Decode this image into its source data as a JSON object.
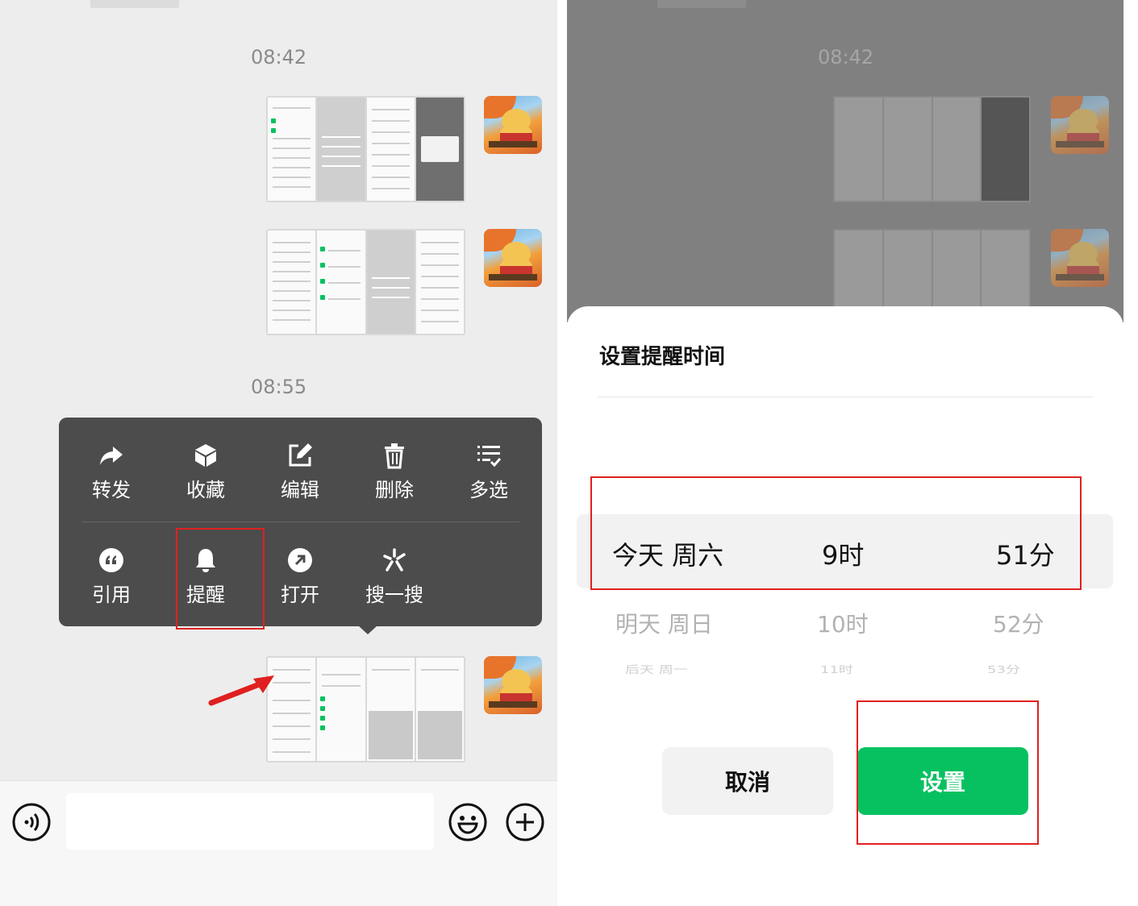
{
  "left": {
    "timestamps": [
      "08:42",
      "08:55"
    ],
    "menu": {
      "row1": [
        {
          "label": "转发",
          "icon": "share-arrow-icon"
        },
        {
          "label": "收藏",
          "icon": "cube-icon"
        },
        {
          "label": "编辑",
          "icon": "edit-icon"
        },
        {
          "label": "删除",
          "icon": "trash-icon"
        },
        {
          "label": "多选",
          "icon": "multi-select-icon"
        }
      ],
      "row2": [
        {
          "label": "引用",
          "icon": "quote-icon"
        },
        {
          "label": "提醒",
          "icon": "bell-icon"
        },
        {
          "label": "打开",
          "icon": "open-arrow-icon"
        },
        {
          "label": "搜一搜",
          "icon": "search-spark-icon"
        }
      ]
    },
    "input_bar": {
      "voice_icon": "voice-icon",
      "emoji_icon": "emoji-icon",
      "plus_icon": "plus-icon"
    }
  },
  "right": {
    "timestamps": [
      "08:42"
    ],
    "sheet": {
      "title": "设置提醒时间",
      "picker": {
        "days": [
          "今天 周六",
          "明天 周日",
          "后天 周一"
        ],
        "hours": [
          "9时",
          "10时",
          "11时"
        ],
        "minutes": [
          "51分",
          "52分",
          "53分"
        ],
        "selected_index": 0
      },
      "cancel_label": "取消",
      "confirm_label": "设置"
    }
  },
  "colors": {
    "accent_green": "#07c160",
    "annotation_red": "#e02020",
    "menu_bg": "#4c4c4c",
    "chat_bg": "#ededed"
  }
}
